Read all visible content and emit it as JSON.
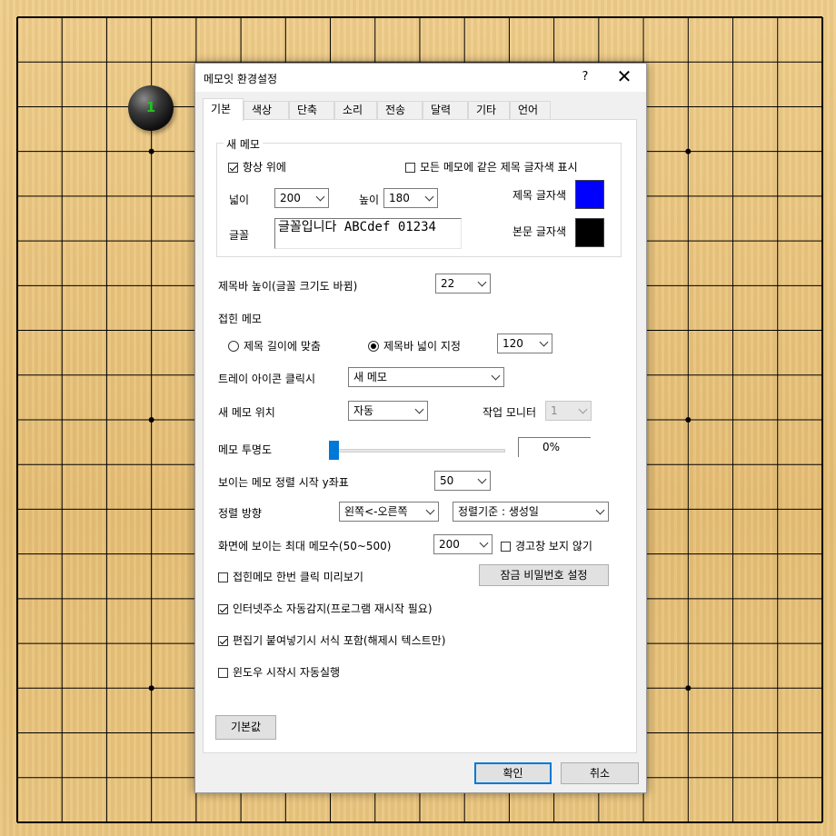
{
  "board": {
    "stone": {
      "color": "black",
      "number": "1"
    }
  },
  "dialog": {
    "title": "메모잇 환경설정",
    "help_label": "?",
    "close_label": "✕",
    "tabs": [
      "기본",
      "색상",
      "단축키",
      "소리",
      "전송",
      "달력",
      "기타",
      "언어"
    ],
    "active_tab": "기본",
    "new_memo": {
      "group_label": "새 메모",
      "always_on_top": {
        "label": "항상 위에",
        "checked": true
      },
      "same_title_color": {
        "label": "모든 메모에 같은 제목 글자색 표시",
        "checked": false
      },
      "width_label": "넓이",
      "width_value": "200",
      "height_label": "높이",
      "height_value": "180",
      "font_label": "글꼴",
      "font_preview": "글꼴입니다 ABCdef 01234",
      "title_color_label": "제목 글자색",
      "title_color": "#0000ff",
      "body_color_label": "본문 글자색",
      "body_color": "#000000"
    },
    "titlebar_height": {
      "label": "제목바 높이(글꼴 크기도 바뀜)",
      "value": "22"
    },
    "folded_memo": {
      "label": "접힌 메모",
      "fit_title": {
        "label": "제목 길이에 맞춤",
        "selected": false
      },
      "set_width": {
        "label": "제목바 넓이 지정",
        "selected": true
      },
      "width_value": "120"
    },
    "tray_click": {
      "label": "트레이 아이콘 클릭시",
      "value": "새 메모"
    },
    "new_memo_position": {
      "label": "새 메모 위치",
      "value": "자동"
    },
    "work_monitor": {
      "label": "작업 모니터",
      "value": "1"
    },
    "transparency": {
      "label": "메모 투명도",
      "value": "0%",
      "level_percent": 0
    },
    "align_start_y": {
      "label": "보이는 메모 정렬 시작 y좌표",
      "value": "50"
    },
    "align_direction": {
      "label": "정렬 방향",
      "direction_value": "왼쪽<-오른쪽",
      "sort_value": "정렬기준 : 생성일"
    },
    "max_memos": {
      "label": "화면에 보이는 최대 메모수(50~500)",
      "value": "200"
    },
    "no_warning": {
      "label": "경고창 보지 않기",
      "checked": false
    },
    "folded_preview": {
      "label": "접힌메모 한번 클릭 미리보기",
      "checked": false
    },
    "lock_password_button": "잠금 비밀번호 설정",
    "url_detect": {
      "label": "인터넷주소 자동감지(프로그램 재시작 필요)",
      "checked": true
    },
    "paste_format": {
      "label": "편집기 붙여넣기시 서식 포함(해제시 텍스트만)",
      "checked": true
    },
    "autostart": {
      "label": "윈도우 시작시 자동실행",
      "checked": false
    },
    "defaults_button": "기본값",
    "ok_button": "확인",
    "cancel_button": "취소"
  }
}
